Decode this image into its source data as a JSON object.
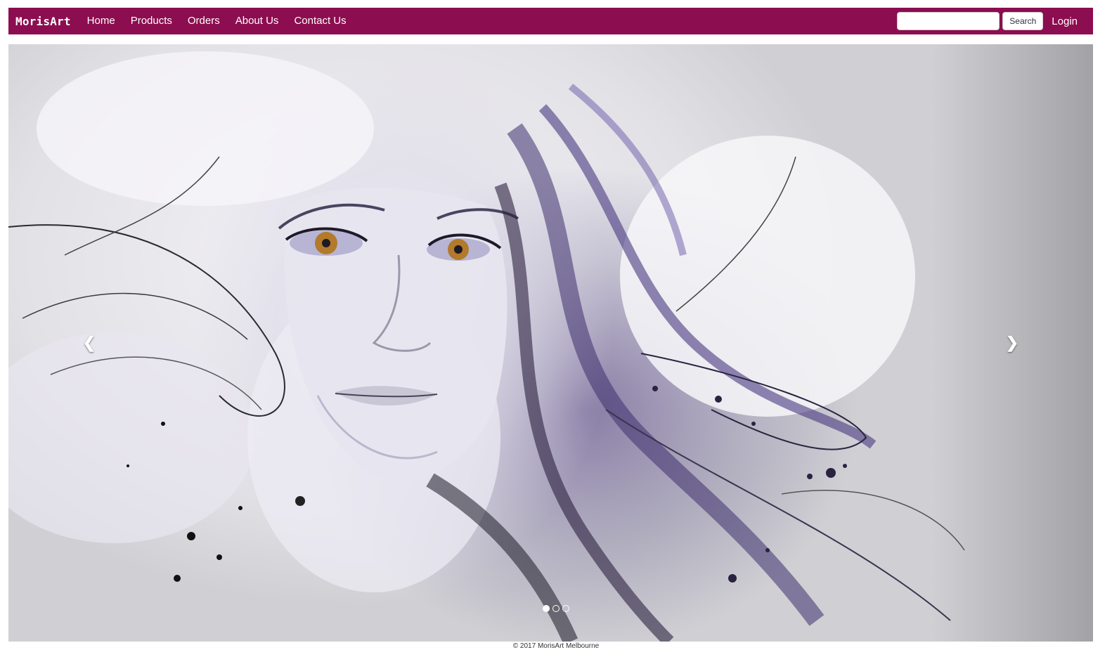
{
  "navbar": {
    "brand": "MorisArt",
    "links": [
      "Home",
      "Products",
      "Orders",
      "About Us",
      "Contact Us"
    ],
    "search": {
      "value": "",
      "placeholder": "",
      "button_label": "Search"
    },
    "login_label": "Login",
    "background_color": "#8c0d50"
  },
  "carousel": {
    "slide_image": "abstract-portrait-artwork",
    "prev_icon": "chevron-left-icon",
    "next_icon": "chevron-right-icon",
    "indicator_count": 3,
    "active_index": 0
  },
  "footer": {
    "text": "© 2017 MorisArt Melbourne"
  }
}
